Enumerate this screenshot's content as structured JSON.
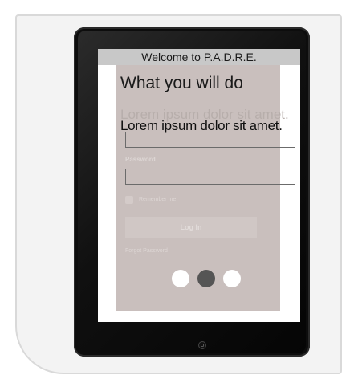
{
  "app": {
    "title": "Welcome to P.A.D.R.E."
  },
  "onboarding": {
    "heading": "What you will do",
    "ghost_text": "Lorem ipsum dolor sit amet.",
    "body_text": "Lorem ipsum dolor sit amet.",
    "current_page": 2,
    "total_pages": 3
  },
  "login": {
    "username_value": "",
    "password_label": "Password",
    "password_value": "",
    "remember_label": "Remember me",
    "login_button": "Log In",
    "forgot_link": "Forgot Password"
  },
  "icons": {
    "home": "home-button-icon"
  },
  "colors": {
    "panel": "#c9bfbd",
    "active_dot": "#555555",
    "inactive_dot": "#ffffff",
    "titlebar": "#c8c8c8"
  }
}
